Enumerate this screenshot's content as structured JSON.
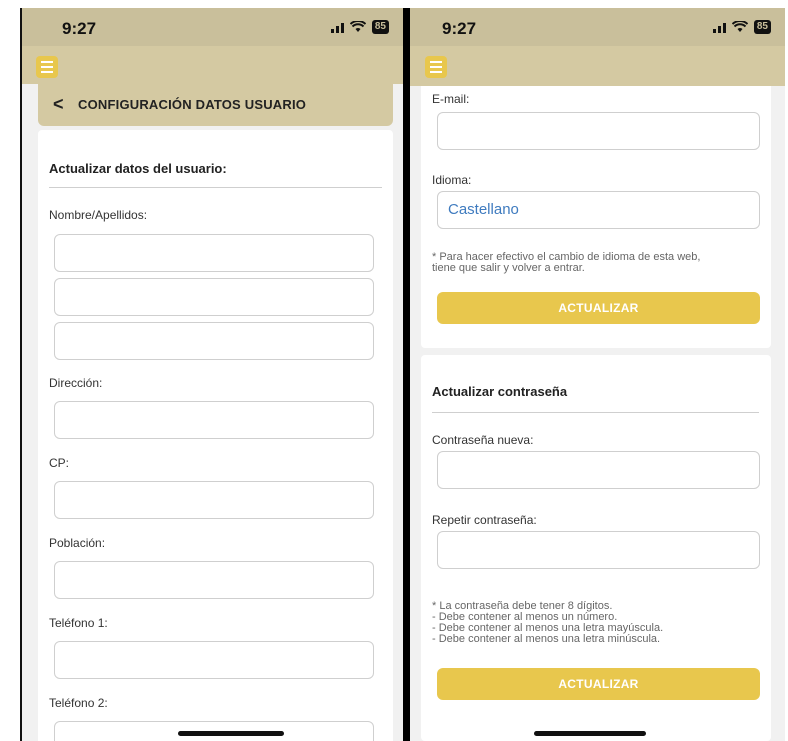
{
  "left": {
    "status": {
      "time": "9:27",
      "battery": "85"
    },
    "header": {
      "back": "<",
      "title": "CONFIGURACIÓN DATOS USUARIO"
    },
    "form": {
      "heading": "Actualizar datos del usuario:",
      "labels": {
        "nombre": "Nombre/Apellidos:",
        "direccion": "Dirección:",
        "cp": "CP:",
        "poblacion": "Población:",
        "telefono1": "Teléfono 1:",
        "telefono2": "Teléfono 2:"
      }
    }
  },
  "right": {
    "status": {
      "time": "9:27",
      "battery": "85"
    },
    "form": {
      "labels": {
        "email": "E-mail:",
        "idioma": "Idioma:"
      },
      "idioma_value": "Castellano",
      "idioma_note": "* Para hacer efectivo el cambio de idioma de esta web,\ntiene que salir y volver a entrar.",
      "update_button": "ACTUALIZAR"
    },
    "password": {
      "heading": "Actualizar contraseña",
      "labels": {
        "nueva": "Contraseña nueva:",
        "repetir": "Repetir contraseña:"
      },
      "rules": "* La contraseña debe tener 8 dígitos.\n- Debe contener al menos un número.\n- Debe contener al menos una letra mayúscula.\n- Debe contener al menos una letra minúscula.",
      "update_button": "ACTUALIZAR"
    }
  },
  "colors": {
    "accent": "#e8c74d",
    "header": "#d4c9a2",
    "statusbar": "#c9bf9b",
    "link_value": "#3f7bbf"
  },
  "icons": [
    "signal-icon",
    "wifi-icon",
    "battery-icon",
    "menu-icon",
    "back-chevron-icon"
  ]
}
